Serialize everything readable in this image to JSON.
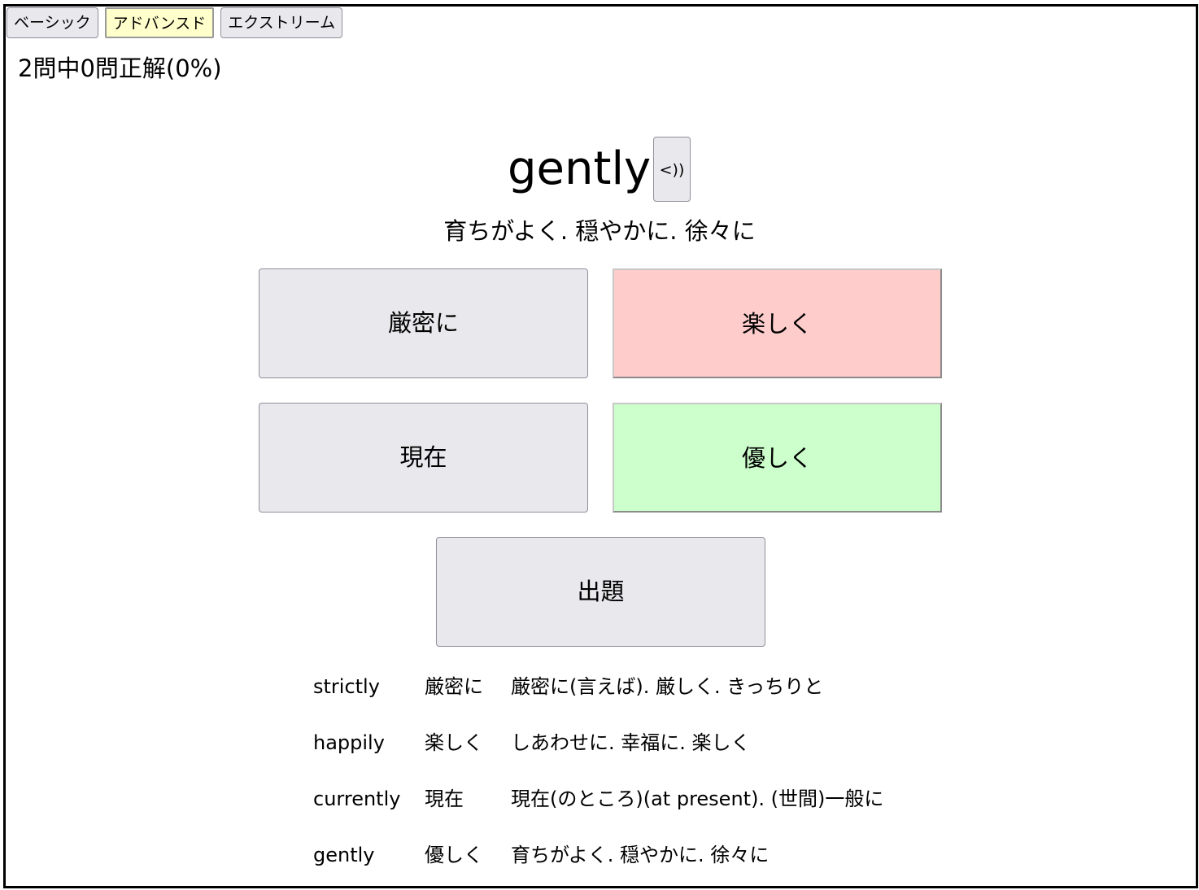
{
  "levels": [
    {
      "label": "ベーシック",
      "active": false
    },
    {
      "label": "アドバンスド",
      "active": true
    },
    {
      "label": "エクストリーム",
      "active": false
    }
  ],
  "score": {
    "text": "2問中0問正解(0%)"
  },
  "question": {
    "word": "gently",
    "speak_label": "<))",
    "meaning": "育ちがよく. 穏やかに. 徐々に"
  },
  "choices": [
    {
      "label": "厳密に",
      "state": "normal"
    },
    {
      "label": "楽しく",
      "state": "wrong"
    },
    {
      "label": "現在",
      "state": "normal"
    },
    {
      "label": "優しく",
      "state": "correct"
    }
  ],
  "next_button": {
    "label": "出題"
  },
  "review": [
    {
      "english": "strictly",
      "japanese": "厳密に",
      "definition": "厳密に(言えば). 厳しく. きっちりと"
    },
    {
      "english": "happily",
      "japanese": "楽しく",
      "definition": "しあわせに. 幸福に. 楽しく"
    },
    {
      "english": "currently",
      "japanese": "現在",
      "definition": "現在(のところ)(at present). (世間)一般に"
    },
    {
      "english": "gently",
      "japanese": "優しく",
      "definition": "育ちがよく. 穏やかに. 徐々に"
    }
  ],
  "colors": {
    "active_level": "#ffffcc",
    "wrong_choice": "#ffcccc",
    "correct_choice": "#ccffcc",
    "button_face": "#e9e9ed"
  }
}
